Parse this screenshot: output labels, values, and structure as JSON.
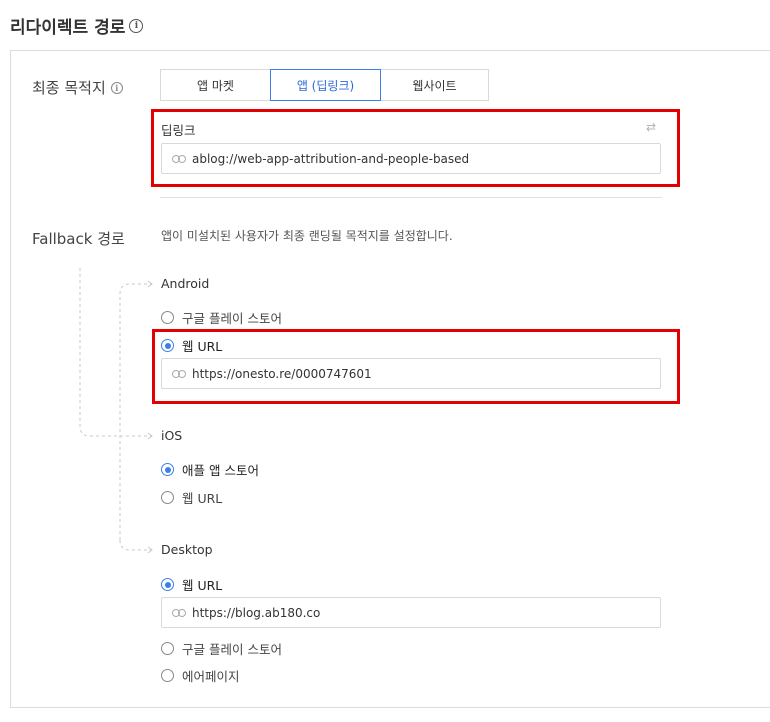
{
  "header": {
    "title": "리다이렉트 경로",
    "info_icon": "info-icon"
  },
  "final_destination": {
    "label": "최종 목적지",
    "info_icon": "info-icon",
    "tabs": [
      {
        "label": "앱 마켓",
        "active": false
      },
      {
        "label": "앱 (딥링크)",
        "active": true
      },
      {
        "label": "웹사이트",
        "active": false
      }
    ],
    "deeplink": {
      "label": "딥링크",
      "swap_icon": "swap-arrows-icon",
      "value": "ablog://web-app-attribution-and-people-based",
      "link_icon": "link-icon"
    }
  },
  "fallback": {
    "label": "Fallback 경로",
    "description": "앱이 미설치된 사용자가 최종 랜딩될 목적지를 설정합니다.",
    "android": {
      "title": "Android",
      "options": [
        {
          "label": "구글 플레이 스토어",
          "checked": false
        },
        {
          "label": "웹 URL",
          "checked": true
        }
      ],
      "url": "https://onesto.re/0000747601"
    },
    "ios": {
      "title": "iOS",
      "options": [
        {
          "label": "애플 앱 스토어",
          "checked": true
        },
        {
          "label": "웹 URL",
          "checked": false
        }
      ]
    },
    "desktop": {
      "title": "Desktop",
      "options": [
        {
          "label": "웹 URL",
          "checked": true
        },
        {
          "label": "구글 플레이 스토어",
          "checked": false
        },
        {
          "label": "에어페이지",
          "checked": false
        }
      ],
      "url": "https://blog.ab180.co"
    }
  },
  "colors": {
    "accent": "#3d7fe6",
    "highlight_box": "#e30000",
    "border": "#d9d9d9"
  }
}
